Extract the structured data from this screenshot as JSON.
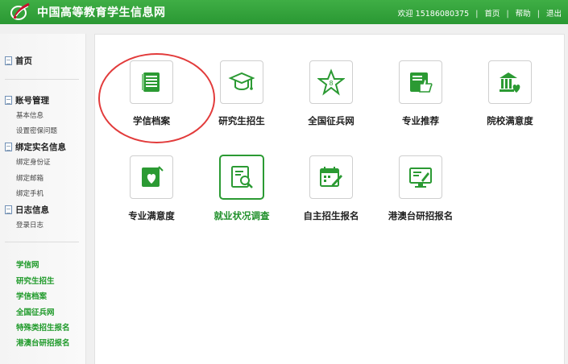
{
  "header": {
    "site_title": "中国高等教育学生信息网",
    "welcome": "欢迎 15186080375",
    "links": [
      "首页",
      "帮助",
      "退出"
    ]
  },
  "sidebar": {
    "home": "首页",
    "account": {
      "title": "账号管理",
      "items": [
        "基本信息",
        "设置密保问题"
      ]
    },
    "realname": {
      "title": "绑定实名信息",
      "items": [
        "绑定身份证",
        "绑定邮箱",
        "绑定手机"
      ]
    },
    "log": {
      "title": "日志信息",
      "items": [
        "登录日志"
      ]
    },
    "quick_links": [
      "学信网",
      "研究生招生",
      "学信档案",
      "全国征兵网",
      "特殊类招生报名",
      "港澳台研招报名"
    ]
  },
  "tiles": [
    {
      "label": "学信档案",
      "icon": "document-icon"
    },
    {
      "label": "研究生招生",
      "icon": "graduation-cap-icon"
    },
    {
      "label": "全国征兵网",
      "icon": "star-icon"
    },
    {
      "label": "专业推荐",
      "icon": "thumbs-up-icon"
    },
    {
      "label": "院校满意度",
      "icon": "building-heart-icon"
    },
    {
      "label": "专业满意度",
      "icon": "book-heart-icon"
    },
    {
      "label": "就业状况调查",
      "icon": "search-report-icon"
    },
    {
      "label": "自主招生报名",
      "icon": "calendar-edit-icon"
    },
    {
      "label": "港澳台研招报名",
      "icon": "monitor-edit-icon"
    }
  ],
  "colors": {
    "brand_green": "#2a9833",
    "highlight_red": "#e23b3b",
    "link_green": "#1f9a2a"
  }
}
